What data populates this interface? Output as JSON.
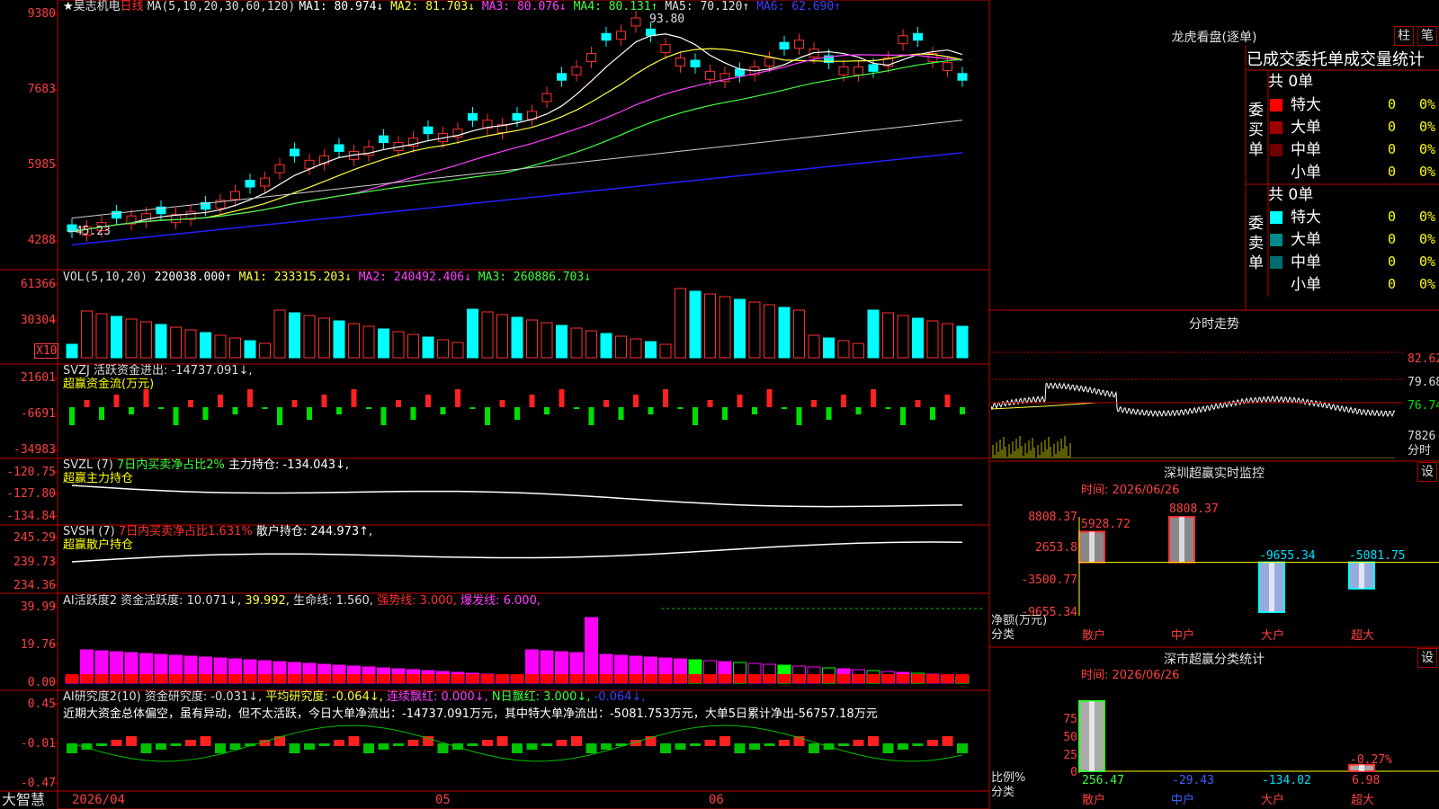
{
  "stock": {
    "name": "昊志机电",
    "period": "日线",
    "star": "★"
  },
  "main": {
    "ma_header": "MA(5,10,20,30,60,120)",
    "ma_values": [
      {
        "label": "MA1: 80.974↓",
        "color": "#ffffff"
      },
      {
        "label": "MA2: 81.703↓",
        "color": "#ffff40"
      },
      {
        "label": "MA3: 80.076↓",
        "color": "#ff40ff"
      },
      {
        "label": "MA4: 80.131↑",
        "color": "#40ff40"
      },
      {
        "label": "MA5: 70.120↑",
        "color": "#e0e0e0"
      },
      {
        "label": "MA6: 62.690↑",
        "color": "#4040ff"
      }
    ],
    "y_ticks": [
      "9380",
      "7683",
      "5985",
      "4288"
    ],
    "high_marker": "93.80",
    "low_marker": "←45.23"
  },
  "vol": {
    "header": "VOL(5,10,20)",
    "value": "220038.000↑",
    "ma1": "MA1: 233315.203↓",
    "ma2": "MA2: 240492.406↓",
    "ma3": "MA3: 260886.703↓",
    "y_ticks": [
      "61366",
      "30304"
    ],
    "unit": "X10"
  },
  "svzj": {
    "header": "SVZJ  活跃资金进出: -14737.091↓,",
    "sub": "超赢资金流(万元)",
    "y_ticks": [
      "21601",
      "-6691",
      "-34983"
    ]
  },
  "svzl": {
    "name": "SVZL (7)",
    "desc": "7日内买卖净占比2%",
    "value": "主力持仓: -134.043↓,",
    "sub": "超赢主力持仓",
    "y_ticks": [
      "-120.75",
      "-127.80",
      "-134.84"
    ]
  },
  "svsh": {
    "name": "SVSH (7)",
    "desc": "7日内买卖净占比1.631%",
    "value": "散户持仓: 244.973↑,",
    "sub": "超赢散户持仓",
    "y_ticks": [
      "245.29",
      "239.73",
      "234.36"
    ]
  },
  "ai1": {
    "name": "AI活跃度2",
    "v1": "资金活跃度: 10.071↓,",
    "v2": "39.992,",
    "v3": "生命线: 1.560,",
    "v4": "强势线: 3.000,",
    "v5": "爆发线: 6.000,",
    "y_ticks": [
      "39.99",
      "19.76",
      "0.00"
    ]
  },
  "ai2": {
    "name": "AI研究度2(10)",
    "v1": "资金研究度: -0.031↓,",
    "v2": "平均研究度: -0.064↓,",
    "v3": "连续飘红: 0.000↓,",
    "v4": "N日飘红: 3.000↓,",
    "v5": "-0.064↓,",
    "comment": "近期大资金总体偏空，虽有异动，但不太活跃，今日大单净流出：-14737.091万元，其中特大单净流出：-5081.753万元，大单5日累计净出-56757.18万元",
    "y_ticks": [
      "0.45",
      "-0.01",
      "-0.47"
    ]
  },
  "footer": {
    "brand": "大智慧",
    "dates": [
      "2026/04",
      "05",
      "06"
    ]
  },
  "lhb": {
    "title": "龙虎看盘(逐单)",
    "btn1": "柱",
    "btn2": "笔",
    "tabs": "已成交委托单成交量统计",
    "buy_label": "委买单",
    "sell_label": "委卖单",
    "buy_total": "共 0单",
    "sell_total": "共 0单",
    "buy_rows": [
      {
        "name": "特大",
        "qty": "0",
        "pct": "0%",
        "color": "#ff0000"
      },
      {
        "name": "大单",
        "qty": "0",
        "pct": "0%",
        "color": "#a00000"
      },
      {
        "name": "中单",
        "qty": "0",
        "pct": "0%",
        "color": "#700000"
      },
      {
        "name": "小单",
        "qty": "0",
        "pct": "0%",
        "color": ""
      }
    ],
    "sell_rows": [
      {
        "name": "特大",
        "qty": "0",
        "pct": "0%",
        "color": "#00ffff"
      },
      {
        "name": "大单",
        "qty": "0",
        "pct": "0%",
        "color": "#008a8a"
      },
      {
        "name": "中单",
        "qty": "0",
        "pct": "0%",
        "color": "#006c6c"
      },
      {
        "name": "小单",
        "qty": "0",
        "pct": "0%",
        "color": ""
      }
    ]
  },
  "intraday": {
    "title": "分时走势",
    "y_ticks": [
      "82.62",
      "79.68",
      "76.74"
    ],
    "vol_tick": "7826",
    "vol_label": "分时"
  },
  "monitor": {
    "title": "深圳超赢实时监控",
    "gear": "设",
    "time": "时间: 2026/06/26",
    "y_ticks": [
      "8808.37",
      "2653.8",
      "-3500.77",
      "-9655.34"
    ],
    "ylabel": "净额(万元)",
    "xlabel": "分类",
    "cats": [
      "散户",
      "中户",
      "大户",
      "超大"
    ],
    "values": [
      "5928.72",
      "8808.37",
      "-9655.34",
      "-5081.75"
    ]
  },
  "classify": {
    "title": "深市超赢分类统计",
    "gear": "设",
    "time": "时间: 2026/06/26",
    "y_ticks": [
      "75",
      "50",
      "25",
      "0"
    ],
    "ylabel": "比例%",
    "xlabel": "分类",
    "cats": [
      "散户",
      "中户",
      "大户",
      "超大"
    ],
    "values": [
      "256.47",
      "-29.43",
      "-134.02",
      "6.98"
    ],
    "top_label": "-0.27%"
  },
  "chart_data": [
    {
      "type": "bar",
      "title": "深圳超赢实时监控",
      "ylabel": "净额(万元)",
      "categories": [
        "散户",
        "中户",
        "大户",
        "超大"
      ],
      "values": [
        5928.72,
        8808.37,
        -9655.34,
        -5081.75
      ],
      "ylim": [
        -9655.34,
        8808.37
      ]
    },
    {
      "type": "bar",
      "title": "深市超赢分类统计",
      "ylabel": "比例%",
      "categories": [
        "散户",
        "中户",
        "大户",
        "超大"
      ],
      "values": [
        256.47,
        -29.43,
        -134.02,
        6.98
      ],
      "ylim": [
        0,
        75
      ]
    }
  ]
}
